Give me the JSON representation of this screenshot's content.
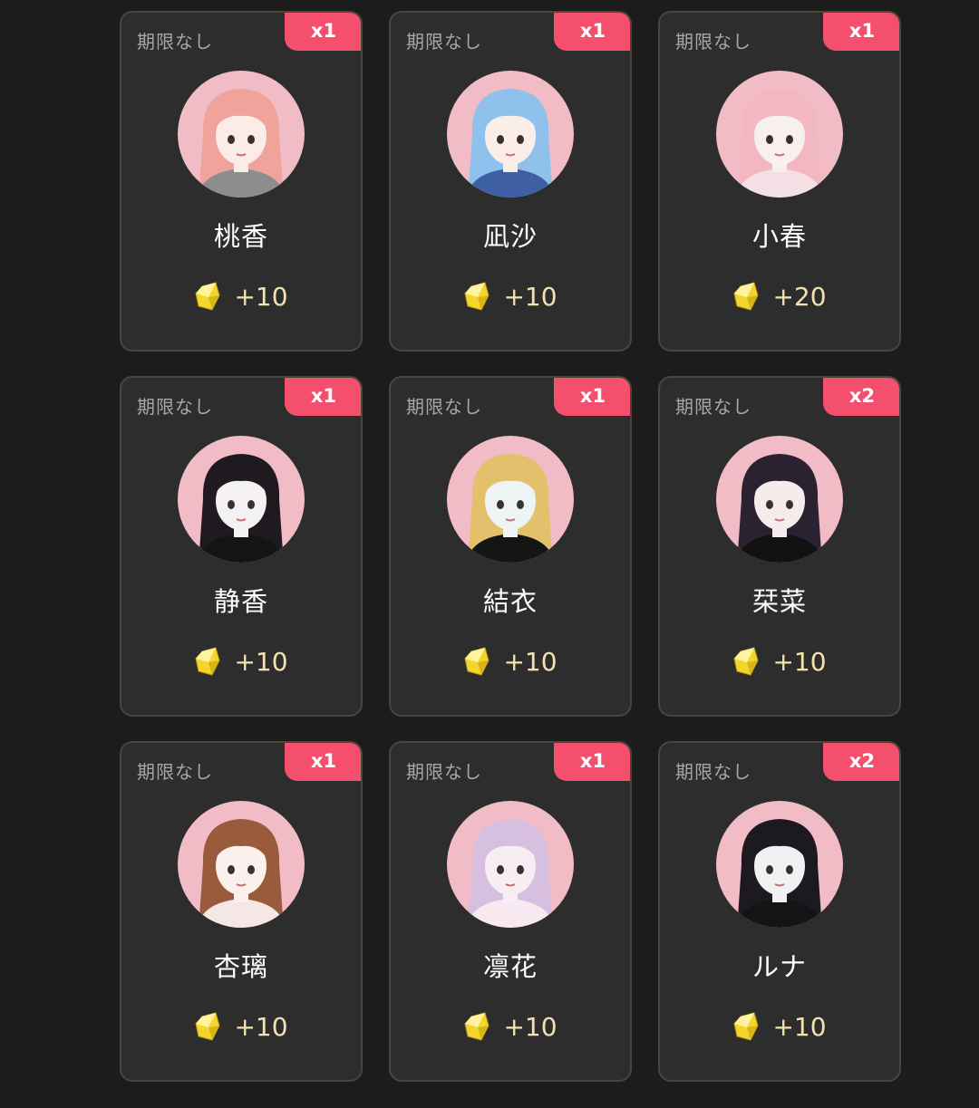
{
  "cards": [
    {
      "expiry": "期限なし",
      "badge": "x1",
      "name": "桃香",
      "reward": "+10",
      "hair": "#f0a39a",
      "skin": "#fbece8",
      "top": "#8d8d8d",
      "icon": "gem-icon"
    },
    {
      "expiry": "期限なし",
      "badge": "x1",
      "name": "凪沙",
      "reward": "+10",
      "hair": "#8fc1ec",
      "skin": "#fbeee9",
      "top": "#3f5fa5",
      "icon": "gem-icon"
    },
    {
      "expiry": "期限なし",
      "badge": "x1",
      "name": "小春",
      "reward": "+20",
      "hair": "#f2b7c1",
      "skin": "#f7f0ee",
      "top": "#f4dfe4",
      "icon": "gem-icon"
    },
    {
      "expiry": "期限なし",
      "badge": "x1",
      "name": "静香",
      "reward": "+10",
      "hair": "#1e1a1f",
      "skin": "#f3f1f1",
      "top": "#141414",
      "icon": "gem-icon"
    },
    {
      "expiry": "期限なし",
      "badge": "x1",
      "name": "結衣",
      "reward": "+10",
      "hair": "#e2c06c",
      "skin": "#eef4f3",
      "top": "#151515",
      "icon": "gem-icon"
    },
    {
      "expiry": "期限なし",
      "badge": "x2",
      "name": "栞菜",
      "reward": "+10",
      "hair": "#2a2230",
      "skin": "#f6eceb",
      "top": "#121212",
      "icon": "gem-icon"
    },
    {
      "expiry": "期限なし",
      "badge": "x1",
      "name": "杏璃",
      "reward": "+10",
      "hair": "#9a5a3c",
      "skin": "#fbf1ec",
      "top": "#f4e7e6",
      "icon": "gem-icon"
    },
    {
      "expiry": "期限なし",
      "badge": "x1",
      "name": "凛花",
      "reward": "+10",
      "hair": "#d7bfe0",
      "skin": "#f6eef2",
      "top": "#f7e9ef",
      "icon": "gem-icon"
    },
    {
      "expiry": "期限なし",
      "badge": "x2",
      "name": "ルナ",
      "reward": "+10",
      "hair": "#1c1a20",
      "skin": "#f1f1f4",
      "top": "#141414",
      "icon": "gem-icon"
    }
  ],
  "colors": {
    "background": "#1c1c1c",
    "card": "#2d2d2d",
    "card_border": "#4a4638",
    "badge": "#f4506d",
    "reward_text": "#f3e2b0",
    "gem": "#f3d52e"
  }
}
